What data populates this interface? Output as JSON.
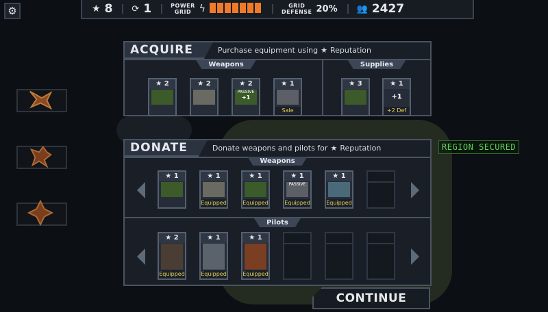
{
  "topbar": {
    "stars": "8",
    "cores": "1",
    "power_grid_label_1": "POWER",
    "power_grid_label_2": "GRID",
    "power_cells_filled": 7,
    "power_cells_total": 7,
    "grid_defense_label_1": "GRID",
    "grid_defense_label_2": "DEFENSE",
    "grid_defense_value": "20%",
    "reputation_total": "2427"
  },
  "map": {
    "region_status": "REGION SECURED"
  },
  "acquire": {
    "title": "ACQUIRE",
    "desc_prefix": "Purchase equipment using",
    "desc_suffix": "Reputation",
    "weapons_label": "Weapons",
    "supplies_label": "Supplies",
    "weapons": [
      {
        "cost": "2",
        "status": ""
      },
      {
        "cost": "2",
        "status": ""
      },
      {
        "cost": "2",
        "status": "",
        "tag": "PASSIVE",
        "tag2": "+1"
      },
      {
        "cost": "1",
        "status": "Sale"
      }
    ],
    "supplies": [
      {
        "cost": "3",
        "status": ""
      },
      {
        "cost": "1",
        "status": "+2 Def",
        "mid": "+1"
      }
    ]
  },
  "donate": {
    "title": "DONATE",
    "desc_prefix": "Donate weapons and pilots for",
    "desc_suffix": "Reputation",
    "weapons_label": "Weapons",
    "pilots_label": "Pilots",
    "weapons": [
      {
        "cost": "1",
        "status": ""
      },
      {
        "cost": "1",
        "status": "Equipped"
      },
      {
        "cost": "1",
        "status": "Equipped"
      },
      {
        "cost": "1",
        "status": "Equipped",
        "tag": "PASSIVE"
      },
      {
        "cost": "1",
        "status": "Equipped"
      }
    ],
    "pilots": [
      {
        "cost": "2",
        "status": "Equipped"
      },
      {
        "cost": "1",
        "status": "Equipped"
      },
      {
        "cost": "1",
        "status": "Equipped"
      }
    ]
  },
  "continue_label": "CONTINUE",
  "colors": {
    "accent_orange": "#f07a2a",
    "equipped_yellow": "#e3d256",
    "secured_green": "#5fd35a"
  }
}
